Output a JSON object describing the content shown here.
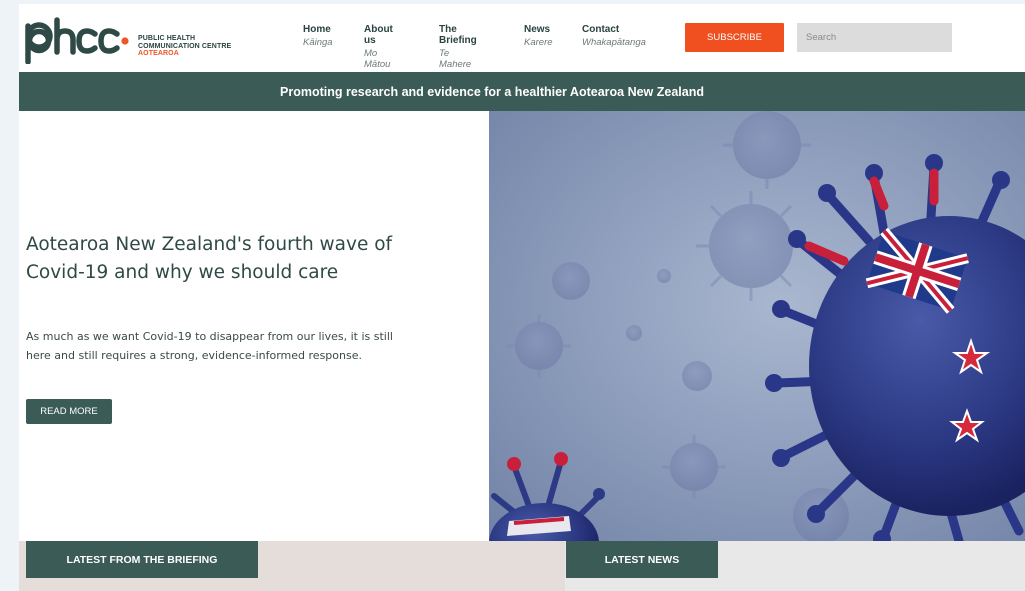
{
  "brand": {
    "logo_mark": "phcc",
    "line1": "PUBLIC HEALTH",
    "line2": "COMMUNICATION CENTRE",
    "line3": "AOTEAROA",
    "accent_color": "#ee5527",
    "primary_color": "#3b5b56"
  },
  "nav": [
    {
      "label": "Home",
      "sub": "Kāinga"
    },
    {
      "label": "About us",
      "sub": "Mo Mātou"
    },
    {
      "label": "The Briefing",
      "sub": "Te Mahere"
    },
    {
      "label": "News",
      "sub": "Karere"
    },
    {
      "label": "Contact",
      "sub": "Whakapātanga"
    }
  ],
  "header": {
    "subscribe_label": "SUBSCRIBE",
    "search_placeholder": "Search"
  },
  "tagline": "Promoting research and evidence for a healthier Aotearoa New Zealand",
  "hero": {
    "title": "Aotearoa New Zealand's fourth wave of Covid-19 and why we should care",
    "body": "As much as we want Covid-19 to disappear from our lives, it is still here and still requires a strong, evidence-informed response.",
    "cta_label": "READ MORE",
    "image_name": "covid-virus-nz-flag-image"
  },
  "sections": {
    "briefing_label": "LATEST FROM THE BRIEFING",
    "news_label": "LATEST NEWS"
  }
}
